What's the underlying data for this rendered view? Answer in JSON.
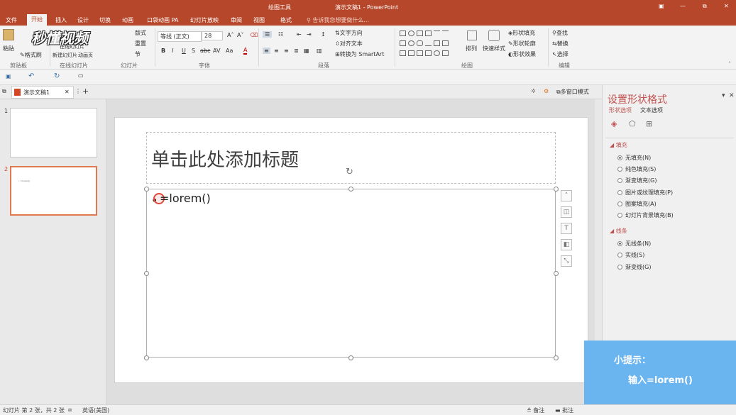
{
  "titlebar": {
    "drawing_tools": "绘图工具",
    "doc_title": "演示文稿1 - PowerPoint",
    "win_btns": [
      "▣",
      "—",
      "⧉",
      "✕"
    ]
  },
  "tabs": [
    "文件",
    "开始",
    "插入",
    "设计",
    "切换",
    "动画",
    "幻灯片放映",
    "审阅",
    "视图",
    "格式"
  ],
  "tabs_extra": [
    "口袋动画 PA"
  ],
  "tell_me": "告诉我您想要做什么...",
  "ribbon": {
    "clipboard": {
      "paste": "粘贴",
      "format_painter": "格式刷",
      "group": "剪贴板"
    },
    "online": {
      "layout": "版式",
      "reset": "重置",
      "section": "节",
      "new_slide": "新建幻灯片",
      "online_slide": "在线幻灯片",
      "animation": "动画页",
      "group": "在线幻灯片",
      "slides_group": "幻灯片"
    },
    "font": {
      "name": "等线 (正文)",
      "size": "28",
      "group": "字体",
      "buttons": [
        "B",
        "I",
        "U",
        "S",
        "abc",
        "AV",
        "Aa",
        "A"
      ]
    },
    "paragraph": {
      "direction": "文字方向",
      "align": "对齐文本",
      "smartart": "转换为 SmartArt",
      "group": "段落"
    },
    "drawing": {
      "arrange": "排列",
      "quick_styles": "快速样式",
      "fill": "形状填充",
      "outline": "形状轮廓",
      "effects": "形状效果",
      "group": "绘图"
    },
    "editing": {
      "find": "查找",
      "replace": "替换",
      "select": "选择",
      "group": "编辑"
    }
  },
  "doctab": {
    "name": "演示文稿1",
    "multiwindow": "多窗口模式"
  },
  "slides": [
    {
      "num": "1"
    },
    {
      "num": "2",
      "mini": "• =lorem()"
    }
  ],
  "slide": {
    "title_placeholder": "单击此处添加标题",
    "body_text": "=lorem()"
  },
  "pane": {
    "title": "设置形状格式",
    "tab_shape": "形状选项",
    "tab_text": "文本选项",
    "fill_header": "填充",
    "fill_options": [
      "无填充(N)",
      "纯色填充(S)",
      "渐变填充(G)",
      "图片或纹理填充(P)",
      "图案填充(A)",
      "幻灯片背景填充(B)"
    ],
    "line_header": "线条",
    "line_options": [
      "无线条(N)",
      "实线(S)",
      "渐变线(G)"
    ]
  },
  "status": {
    "slide_info": "幻灯片 第 2 张，共 2 张",
    "lang": "英语(美国)",
    "notes": "备注",
    "comments": "批注"
  },
  "watermark": "秒懂视频",
  "tip": {
    "title": "小提示：",
    "text": "输入=lorem()"
  },
  "colors": {
    "accent": "#b7472a",
    "tip_bg": "#6ab4ef"
  }
}
